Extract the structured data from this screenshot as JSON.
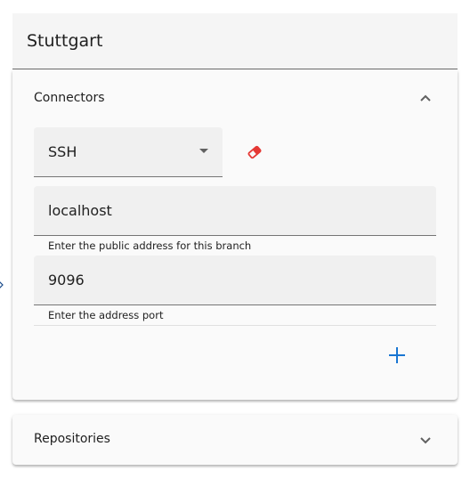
{
  "title": "Stuttgart",
  "connectors": {
    "header_label": "Connectors",
    "expanded": true,
    "chevron_icon": "chevron-up-icon",
    "select": {
      "value": "SSH",
      "caret_icon": "arrow-drop-down-icon"
    },
    "remove_icon": "eraser-icon",
    "address_field": {
      "value": "localhost",
      "hint": "Enter the public address for this branch"
    },
    "port_field": {
      "value": "9096",
      "hint": "Enter the address port"
    },
    "add_icon": "plus-icon"
  },
  "repositories": {
    "header_label": "Repositories",
    "expanded": false,
    "chevron_icon": "chevron-down-icon"
  },
  "colors": {
    "accent": "#1976d2",
    "danger": "#e53935",
    "field_bg": "#f0f0f0",
    "panel_bg": "#fafafa"
  }
}
